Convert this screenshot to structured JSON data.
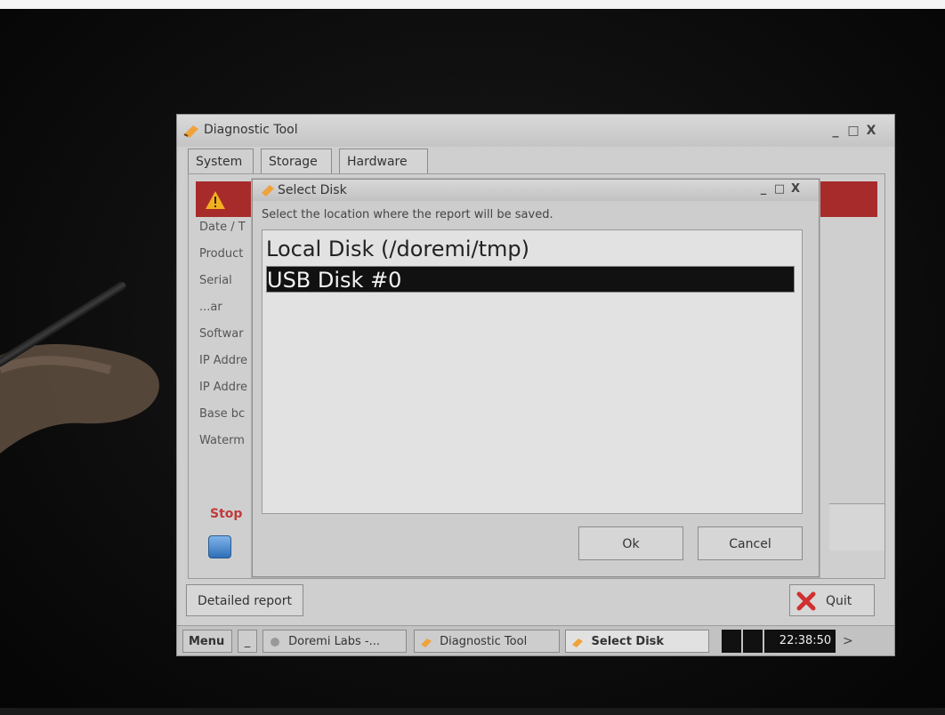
{
  "window": {
    "title": "Diagnostic Tool",
    "controls": [
      "_",
      "□",
      "X"
    ]
  },
  "tabs": [
    {
      "label": "System",
      "active": true
    },
    {
      "label": "Storage",
      "active": false
    },
    {
      "label": "Hardware",
      "active": false
    }
  ],
  "left_labels": [
    "Date / T",
    "Product",
    "Serial",
    "...ar",
    "Softwar",
    "IP Addre",
    "IP Addre",
    "Base bc",
    "Waterm"
  ],
  "stop_label": "Stop",
  "detail_button": "Detailed report",
  "quit_button": "Quit",
  "dialog": {
    "title": "Select Disk",
    "subtitle": "Select the location where the report will be saved.",
    "items": [
      {
        "label": "Local Disk (/doremi/tmp)",
        "selected": false
      },
      {
        "label": "USB Disk #0",
        "selected": true
      }
    ],
    "ok_label": "Ok",
    "cancel_label": "Cancel"
  },
  "taskbar": {
    "menu_label": "Menu",
    "min_label": "_",
    "items": [
      {
        "label": "Doremi Labs -...",
        "active": false
      },
      {
        "label": "Diagnostic Tool",
        "active": false
      },
      {
        "label": "Select Disk",
        "active": true
      }
    ],
    "clock": "22:38:50",
    "arrow": ">"
  },
  "colors": {
    "alert": "#a82b2b",
    "stop": "#c23a3a",
    "selected_bg": "#111111"
  }
}
